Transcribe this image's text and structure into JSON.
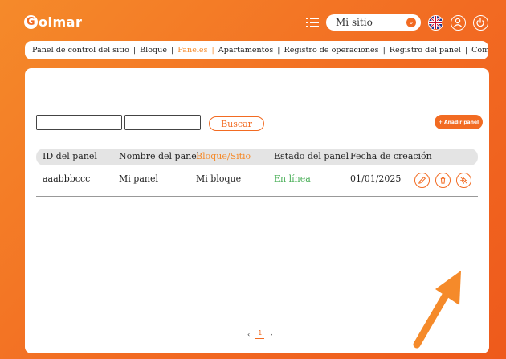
{
  "brand": {
    "logo_text": "olmar",
    "logo_letter": "G"
  },
  "header": {
    "site_select_value": "Mi sitio",
    "icons": [
      "list-icon",
      "uk-flag-icon",
      "user-icon",
      "logout-icon"
    ]
  },
  "nav": {
    "items": [
      "Panel de control del sitio",
      "Bloque",
      "Paneles",
      "Apartamentos",
      "Registro de operaciones",
      "Registro del panel",
      "Comunicados"
    ],
    "active_index": 2
  },
  "toolbar": {
    "search_label": "Buscar",
    "add_label": "+ Añadir panel"
  },
  "table": {
    "columns": [
      "ID del panel",
      "Nombre del panel",
      "Bloque/Sitio",
      "Estado del panel",
      "Fecha de creación"
    ],
    "rows": [
      {
        "id": "aaabbbccc",
        "name": "Mi panel",
        "block": "Mi bloque",
        "status": "En línea",
        "date": "01/01/2025"
      }
    ]
  },
  "pagination": {
    "prev": "‹",
    "current": "1",
    "next": "›"
  },
  "colors": {
    "accent": "#f26b22",
    "online": "#4cb05a",
    "arrow": "#f58a2a"
  }
}
